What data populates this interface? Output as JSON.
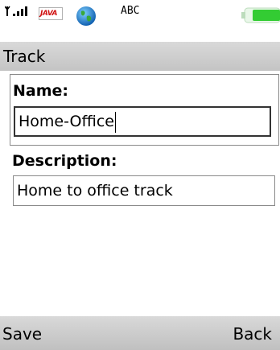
{
  "status_bar": {
    "signal_icon": "signal-strength-icon",
    "java_badge": "JAVA",
    "globe_icon": "globe-icon",
    "input_mode": "ABC",
    "battery_icon": "battery-icon"
  },
  "screen": {
    "title": "Track"
  },
  "form": {
    "name_label": "Name:",
    "name_value": "Home-Office",
    "description_label": "Description:",
    "description_value": "Home to office track"
  },
  "softkeys": {
    "left": "Save",
    "right": "Back"
  },
  "colors": {
    "bar_gray": "#cccccc",
    "java_red": "#d01010",
    "battery_green": "#33cc33"
  }
}
